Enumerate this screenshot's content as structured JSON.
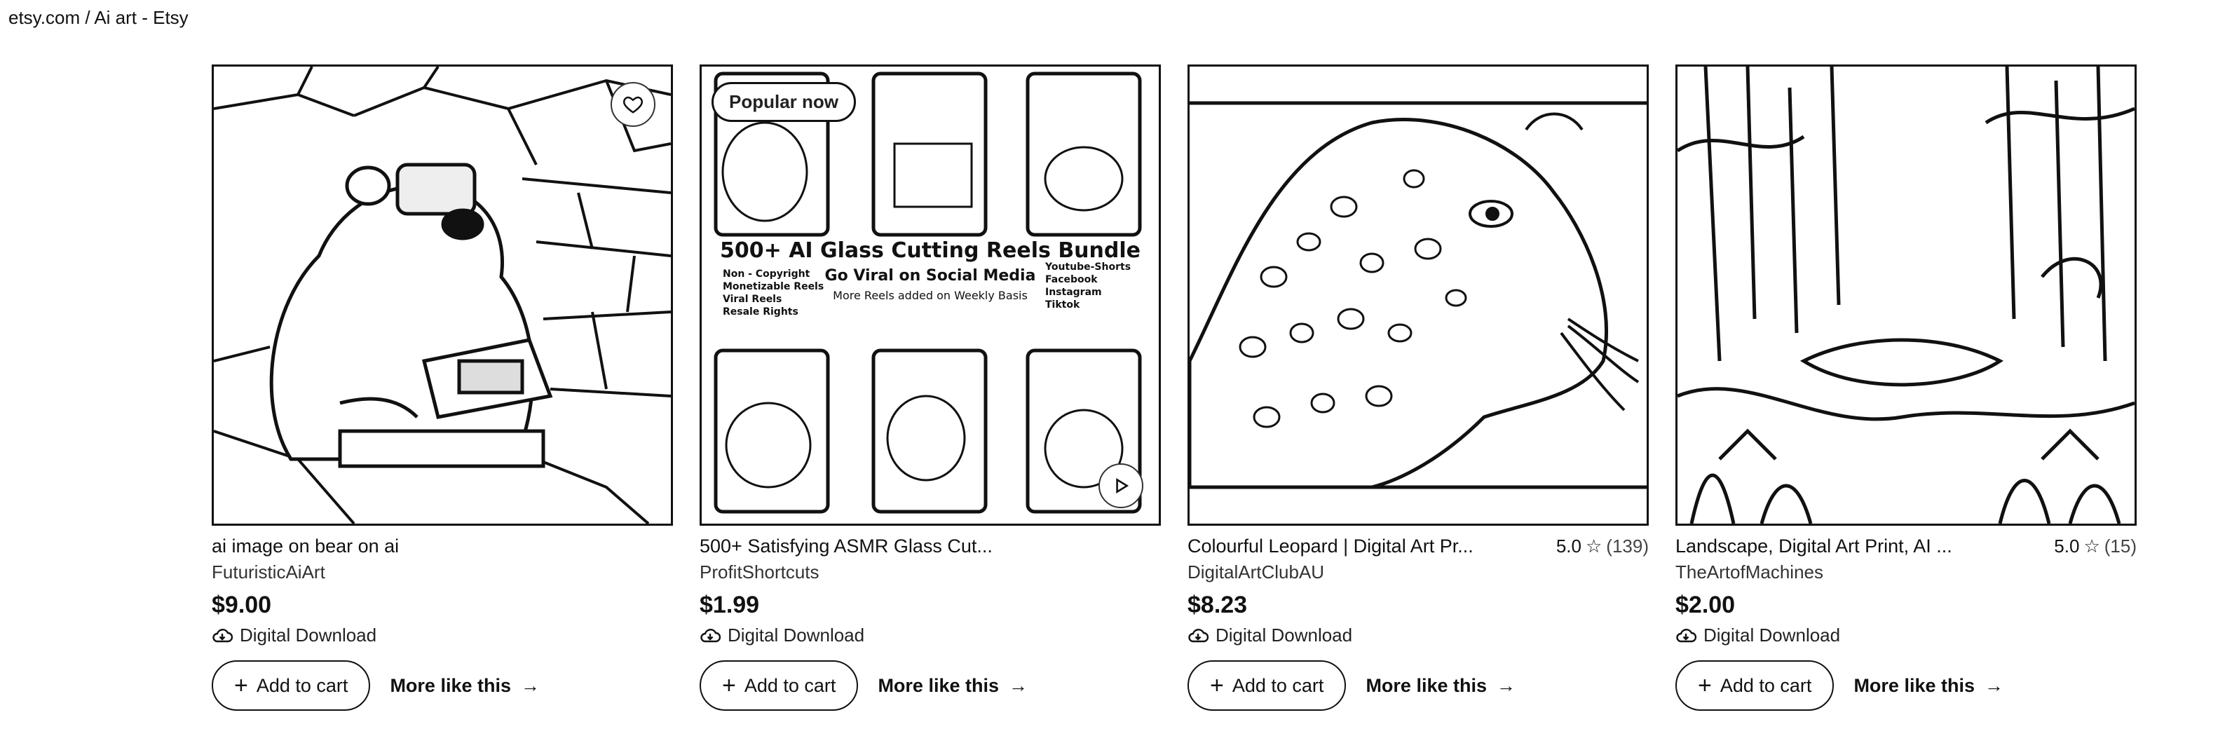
{
  "breadcrumb": "etsy.com / Ai art - Etsy",
  "listings": [
    {
      "title": "ai image on bear on ai",
      "shop": "FuturisticAiArt",
      "price": "$9.00",
      "delivery": "Digital Download",
      "add_to_cart": "Add to cart",
      "more_like_this": "More like this",
      "rating": "",
      "rating_count": ""
    },
    {
      "title": "500+ Satisfying ASMR Glass Cut...",
      "shop": "ProfitShortcuts",
      "price": "$1.99",
      "delivery": "Digital Download",
      "add_to_cart": "Add to cart",
      "more_like_this": "More like this",
      "badge": "Popular now",
      "rating": "",
      "rating_count": "",
      "image_text": {
        "headline": "500+ AI Glass Cutting Reels Bundle",
        "subheadline": "Go Viral on Social Media",
        "subline": "More Reels added on Weekly Basis",
        "features": [
          "Non - Copyright",
          "Monetizable Reels",
          "Viral Reels",
          "Resale Rights"
        ],
        "platforms": [
          "Youtube-Shorts",
          "Facebook",
          "Instagram",
          "Tiktok"
        ]
      }
    },
    {
      "title": "Colourful Leopard | Digital Art Pr...",
      "shop": "DigitalArtClubAU",
      "price": "$8.23",
      "delivery": "Digital Download",
      "add_to_cart": "Add to cart",
      "more_like_this": "More like this",
      "rating": "5.0",
      "rating_count": "(139)"
    },
    {
      "title": "Landscape, Digital Art Print, AI ...",
      "shop": "TheArtofMachines",
      "price": "$2.00",
      "delivery": "Digital Download",
      "add_to_cart": "Add to cart",
      "more_like_this": "More like this",
      "rating": "5.0",
      "rating_count": "(15)"
    }
  ]
}
